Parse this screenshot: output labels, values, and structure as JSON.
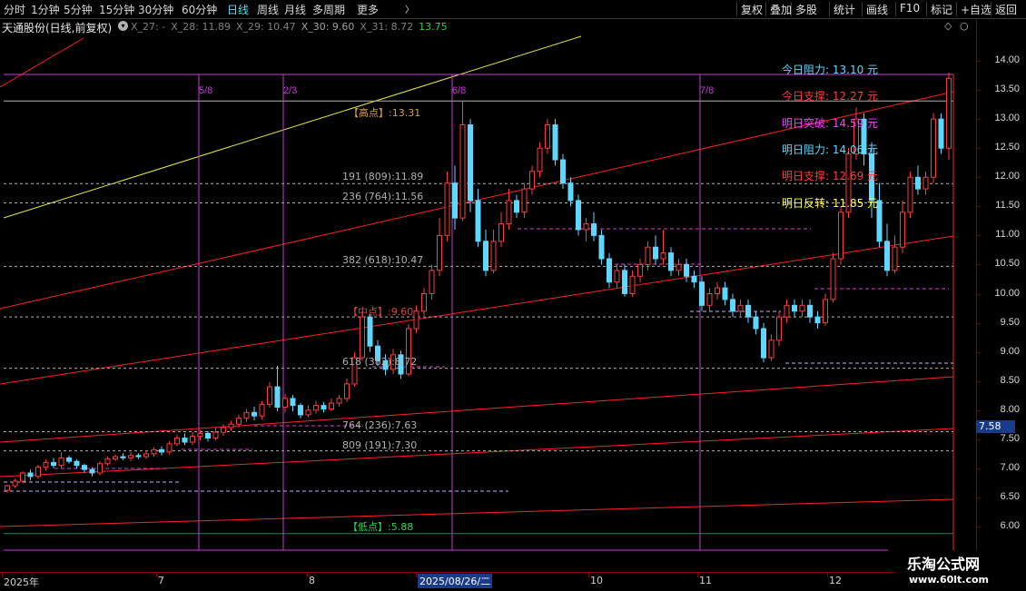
{
  "toolbar": {
    "tabs": [
      "分时",
      "1分钟",
      "5分钟",
      "15分钟",
      "30分钟",
      "60分钟",
      "日线",
      "周线",
      "月线",
      "多周期",
      "更多"
    ],
    "active_tab": "日线",
    "more_arrow": "〉",
    "right_buttons": [
      "复权",
      "叠加",
      "多股",
      "统计",
      "画线",
      "F10",
      "标记",
      "+自选",
      "返回"
    ]
  },
  "info": {
    "stock_title": "天通股份(日线,前复权)",
    "indicators": [
      {
        "text": "X_27: -",
        "color": "#808080"
      },
      {
        "text": "X_28: 11.89",
        "color": "#808080"
      },
      {
        "text": "X_29: 10.47",
        "color": "#808080"
      },
      {
        "text": "X_30: 9.60",
        "color": "#a0a0a0"
      },
      {
        "text": "X_31: 8.72",
        "color": "#808080"
      },
      {
        "text": "13.75",
        "color": "#2bd64a"
      }
    ]
  },
  "yaxis": {
    "ticks": [
      "14.00",
      "13.50",
      "13.00",
      "12.50",
      "12.00",
      "11.50",
      "11.00",
      "10.50",
      "10.00",
      "9.50",
      "9.00",
      "8.50",
      "8.00",
      "7.50",
      "7.00",
      "6.50",
      "6.00"
    ],
    "cursor_price": "7.58"
  },
  "xaxis": {
    "labels": [
      "2025年",
      "7",
      "8",
      "2025/08/26/二",
      "10",
      "11",
      "12"
    ]
  },
  "fib_labels": {
    "high": "【高点】:13.31",
    "l191": "191 (809):11.89",
    "l236": "236 (764):11.56",
    "l382": "382 (618):10.47",
    "mid": "【中点】:9.60",
    "l618": "618 (382):8.72",
    "l764": "764 (236):7.63",
    "l809": "809 (191):7.30",
    "low": "【低点】:5.88"
  },
  "vertical_labels": [
    "5/8",
    "2/3",
    "6/8",
    "7/8"
  ],
  "predictions": [
    {
      "label": "今日阻力:",
      "value": "13.10",
      "unit": "元",
      "color": "#5fd7ff"
    },
    {
      "label": "今日支撑:",
      "value": "12.27",
      "unit": "元",
      "color": "#ff3b3b"
    },
    {
      "label": "明日突破:",
      "value": "14.59",
      "unit": "元",
      "color": "#ff3bff"
    },
    {
      "label": "明日阻力:",
      "value": "14.06",
      "unit": "元",
      "color": "#5fd7ff"
    },
    {
      "label": "明日支撑:",
      "value": "12.69",
      "unit": "元",
      "color": "#ff3b3b"
    },
    {
      "label": "明日反转:",
      "value": "11.85",
      "unit": "元",
      "color": "#ffff3b"
    }
  ],
  "logo": {
    "name": "乐淘公式网",
    "url": "www.60lt.com"
  },
  "colors": {
    "up": "#ff3b3b",
    "down": "#5fd7ff",
    "fib": "#b0b0b0",
    "vertical": "#c83bd8",
    "trend": "#ff2020",
    "yellow_line": "#e8e83b"
  },
  "chart_data": {
    "type": "candlestick",
    "title": "天通股份(日线,前复权)",
    "ylim": [
      5.8,
      14.2
    ],
    "x_labels": [
      "2025年",
      "7",
      "8",
      "2025/08/26/二",
      "10",
      "11",
      "12"
    ],
    "levels": {
      "high": 13.31,
      "191": 11.89,
      "236": 11.56,
      "382": 10.47,
      "mid": 9.6,
      "618": 8.72,
      "764": 7.63,
      "809": 7.3,
      "low": 5.88
    },
    "candles": [
      [
        6.62,
        6.7,
        6.58,
        6.72
      ],
      [
        6.7,
        6.78,
        6.66,
        6.82
      ],
      [
        6.78,
        6.92,
        6.74,
        6.95
      ],
      [
        6.92,
        6.86,
        6.8,
        6.98
      ],
      [
        6.86,
        7.02,
        6.82,
        7.06
      ],
      [
        7.02,
        7.1,
        6.96,
        7.15
      ],
      [
        7.1,
        7.05,
        7.0,
        7.18
      ],
      [
        7.05,
        7.18,
        7.0,
        7.28
      ],
      [
        7.18,
        7.12,
        7.08,
        7.22
      ],
      [
        7.12,
        7.05,
        7.0,
        7.15
      ],
      [
        7.05,
        6.98,
        6.92,
        7.08
      ],
      [
        6.98,
        6.92,
        6.86,
        7.02
      ],
      [
        6.92,
        7.08,
        6.88,
        7.12
      ],
      [
        7.08,
        7.16,
        7.04,
        7.2
      ],
      [
        7.16,
        7.2,
        7.12,
        7.24
      ],
      [
        7.2,
        7.18,
        7.14,
        7.26
      ],
      [
        7.18,
        7.22,
        7.12,
        7.28
      ],
      [
        7.22,
        7.2,
        7.16,
        7.26
      ],
      [
        7.2,
        7.25,
        7.16,
        7.3
      ],
      [
        7.25,
        7.32,
        7.2,
        7.36
      ],
      [
        7.32,
        7.28,
        7.22,
        7.38
      ],
      [
        7.28,
        7.42,
        7.24,
        7.46
      ],
      [
        7.42,
        7.52,
        7.38,
        7.58
      ],
      [
        7.52,
        7.45,
        7.4,
        7.6
      ],
      [
        7.45,
        7.55,
        7.4,
        7.62
      ],
      [
        7.55,
        7.6,
        7.48,
        7.66
      ],
      [
        7.6,
        7.52,
        7.46,
        7.64
      ],
      [
        7.52,
        7.62,
        7.48,
        7.7
      ],
      [
        7.62,
        7.7,
        7.56,
        7.76
      ],
      [
        7.7,
        7.76,
        7.64,
        7.82
      ],
      [
        7.76,
        7.86,
        7.7,
        7.92
      ],
      [
        7.86,
        7.96,
        7.8,
        8.02
      ],
      [
        7.96,
        7.9,
        7.82,
        8.06
      ],
      [
        7.9,
        8.1,
        7.84,
        8.16
      ],
      [
        8.1,
        8.4,
        8.04,
        8.48
      ],
      [
        8.4,
        8.05,
        7.98,
        8.76
      ],
      [
        8.05,
        8.2,
        7.96,
        8.28
      ],
      [
        8.2,
        8.08,
        7.98,
        8.26
      ],
      [
        8.08,
        7.92,
        7.86,
        8.12
      ],
      [
        7.92,
        8.0,
        7.88,
        8.08
      ],
      [
        8.0,
        8.08,
        7.94,
        8.16
      ],
      [
        8.08,
        8.02,
        7.96,
        8.14
      ],
      [
        8.02,
        8.12,
        7.98,
        8.2
      ],
      [
        8.12,
        8.2,
        8.06,
        8.26
      ],
      [
        8.2,
        8.45,
        8.14,
        8.54
      ],
      [
        8.45,
        8.9,
        8.4,
        9.0
      ],
      [
        8.9,
        9.6,
        8.85,
        9.7
      ],
      [
        9.6,
        9.1,
        9.0,
        9.66
      ],
      [
        9.1,
        8.85,
        8.76,
        9.2
      ],
      [
        8.85,
        8.7,
        8.6,
        8.96
      ],
      [
        8.7,
        8.95,
        8.62,
        9.05
      ],
      [
        8.95,
        8.62,
        8.54,
        9.02
      ],
      [
        8.62,
        9.4,
        8.58,
        9.48
      ],
      [
        9.4,
        9.7,
        9.32,
        9.8
      ],
      [
        9.7,
        10.0,
        9.62,
        10.1
      ],
      [
        10.0,
        10.4,
        9.9,
        10.5
      ],
      [
        10.4,
        11.0,
        10.3,
        11.3
      ],
      [
        11.0,
        11.9,
        10.9,
        12.1
      ],
      [
        11.9,
        11.3,
        11.1,
        12.2
      ],
      [
        11.3,
        12.9,
        11.25,
        13.31
      ],
      [
        12.9,
        11.6,
        11.4,
        13.0
      ],
      [
        11.6,
        10.9,
        10.8,
        11.8
      ],
      [
        10.9,
        10.4,
        10.3,
        11.1
      ],
      [
        10.4,
        10.9,
        10.35,
        11.1
      ],
      [
        10.9,
        11.2,
        10.8,
        11.4
      ],
      [
        11.2,
        11.6,
        11.1,
        11.8
      ],
      [
        11.6,
        11.4,
        11.3,
        11.7
      ],
      [
        11.4,
        11.8,
        11.3,
        11.9
      ],
      [
        11.8,
        12.1,
        11.7,
        12.2
      ],
      [
        12.1,
        12.5,
        12.0,
        12.6
      ],
      [
        12.5,
        12.9,
        12.4,
        13.0
      ],
      [
        12.9,
        12.3,
        12.2,
        13.0
      ],
      [
        12.3,
        11.9,
        11.8,
        12.4
      ],
      [
        11.9,
        11.6,
        11.5,
        12.0
      ],
      [
        11.6,
        11.1,
        11.0,
        11.7
      ],
      [
        11.1,
        11.2,
        10.9,
        11.3
      ],
      [
        11.2,
        11.0,
        10.9,
        11.4
      ],
      [
        11.0,
        10.6,
        10.5,
        11.1
      ],
      [
        10.6,
        10.2,
        10.1,
        10.7
      ],
      [
        10.2,
        10.4,
        10.1,
        10.5
      ],
      [
        10.4,
        10.0,
        9.95,
        10.5
      ],
      [
        10.0,
        10.3,
        9.95,
        10.4
      ],
      [
        10.3,
        10.5,
        10.2,
        10.6
      ],
      [
        10.5,
        10.8,
        10.4,
        10.9
      ],
      [
        10.8,
        10.6,
        10.5,
        11.0
      ],
      [
        10.6,
        10.7,
        10.5,
        11.1
      ],
      [
        10.7,
        10.4,
        10.3,
        10.8
      ],
      [
        10.4,
        10.5,
        10.3,
        10.6
      ],
      [
        10.5,
        10.3,
        10.2,
        10.6
      ],
      [
        10.3,
        10.2,
        10.1,
        10.4
      ],
      [
        10.2,
        9.8,
        9.7,
        10.3
      ],
      [
        9.8,
        10.0,
        9.7,
        10.1
      ],
      [
        10.0,
        10.1,
        9.9,
        10.2
      ],
      [
        10.1,
        9.9,
        9.8,
        10.2
      ],
      [
        9.9,
        9.7,
        9.6,
        10.0
      ],
      [
        9.7,
        9.8,
        9.6,
        9.9
      ],
      [
        9.8,
        9.6,
        9.5,
        9.9
      ],
      [
        9.6,
        9.4,
        9.3,
        9.7
      ],
      [
        9.4,
        8.9,
        8.82,
        9.5
      ],
      [
        8.9,
        9.2,
        8.85,
        9.3
      ],
      [
        9.2,
        9.6,
        9.1,
        9.7
      ],
      [
        9.6,
        9.8,
        9.5,
        9.9
      ],
      [
        9.8,
        9.7,
        9.6,
        9.9
      ],
      [
        9.7,
        9.8,
        9.6,
        9.9
      ],
      [
        9.8,
        9.6,
        9.5,
        9.9
      ],
      [
        9.6,
        9.5,
        9.4,
        9.7
      ],
      [
        9.5,
        9.9,
        9.45,
        10.0
      ],
      [
        9.9,
        10.6,
        9.85,
        10.7
      ],
      [
        10.6,
        11.4,
        10.5,
        11.5
      ],
      [
        11.4,
        12.4,
        11.3,
        12.5
      ],
      [
        12.4,
        13.0,
        12.3,
        13.2
      ],
      [
        13.0,
        12.4,
        12.2,
        13.1
      ],
      [
        12.4,
        11.6,
        11.3,
        12.6
      ],
      [
        11.6,
        10.9,
        10.8,
        11.9
      ],
      [
        10.9,
        10.4,
        10.3,
        11.2
      ],
      [
        10.4,
        10.8,
        10.35,
        11.0
      ],
      [
        10.8,
        11.4,
        10.7,
        11.6
      ],
      [
        11.4,
        12.0,
        11.3,
        12.1
      ],
      [
        12.0,
        11.8,
        11.7,
        12.2
      ],
      [
        11.8,
        12.0,
        11.7,
        12.1
      ],
      [
        12.0,
        13.0,
        11.9,
        13.1
      ],
      [
        13.0,
        12.5,
        12.4,
        13.1
      ],
      [
        12.5,
        13.7,
        12.3,
        13.8
      ]
    ]
  }
}
